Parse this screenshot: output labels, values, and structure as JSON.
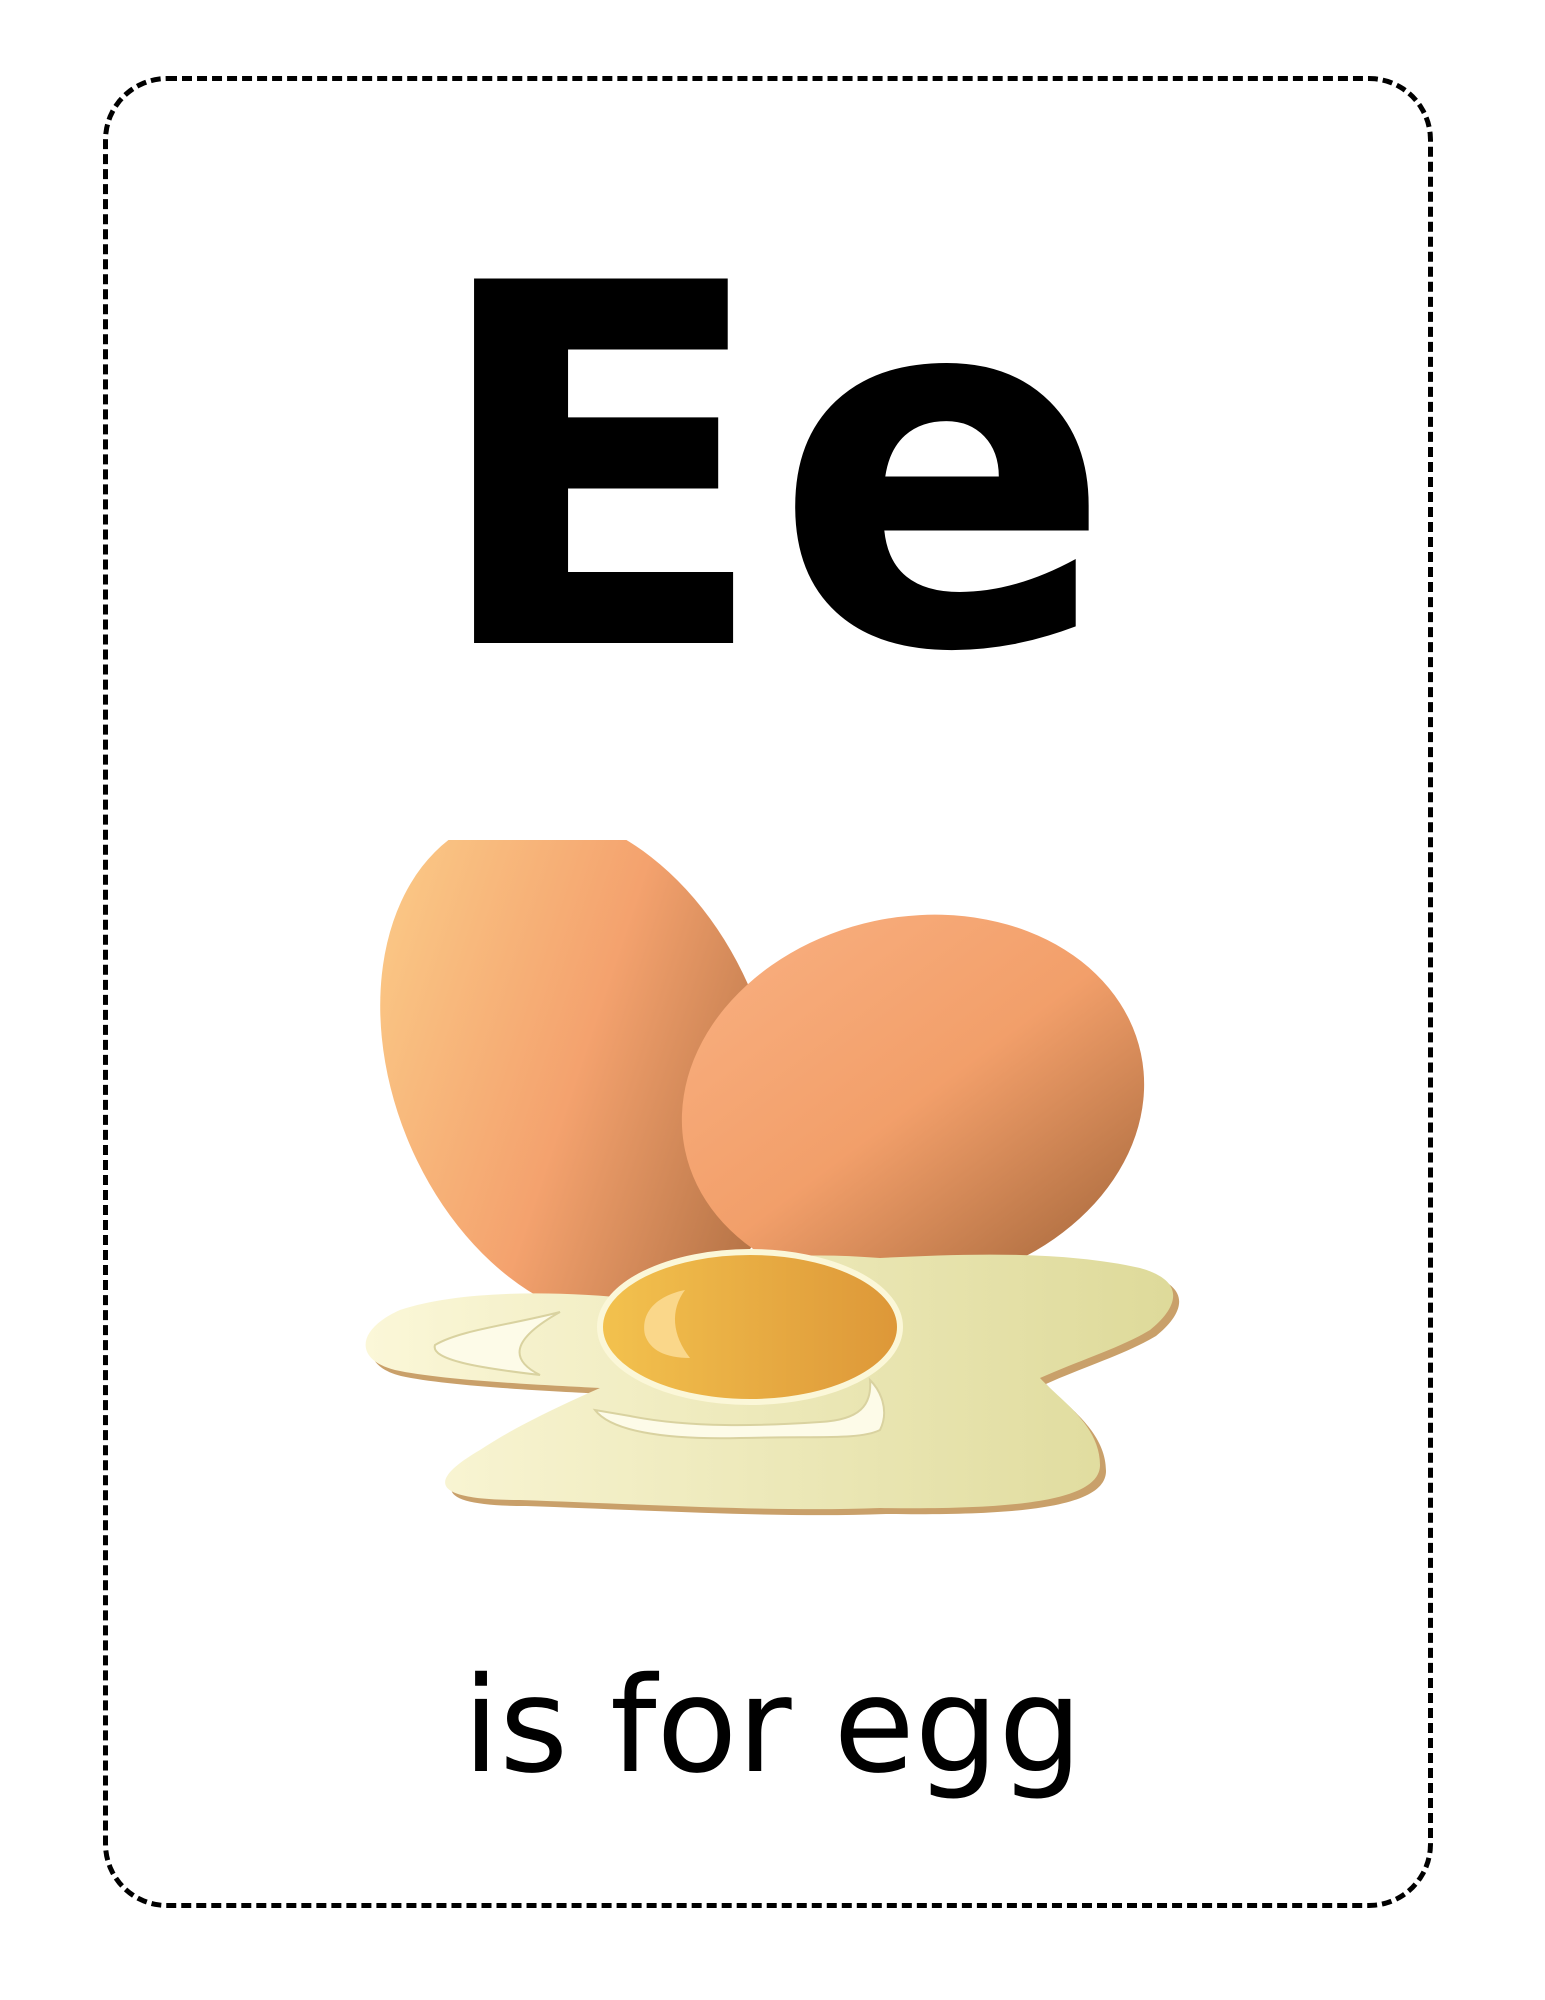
{
  "card": {
    "letter": "Ee",
    "caption": "is for egg"
  },
  "illustration": {
    "subject": "eggs-and-cracked-egg",
    "colors": {
      "shell_light": "#FAC584",
      "shell_mid": "#F4A26E",
      "shell_dark": "#A96A3E",
      "albumen_light": "#FBF7D8",
      "albumen_dark": "#DEDA9A",
      "albumen_edge": "#C9A06A",
      "yolk_light": "#F3C24E",
      "yolk_dark": "#DD9738"
    }
  }
}
